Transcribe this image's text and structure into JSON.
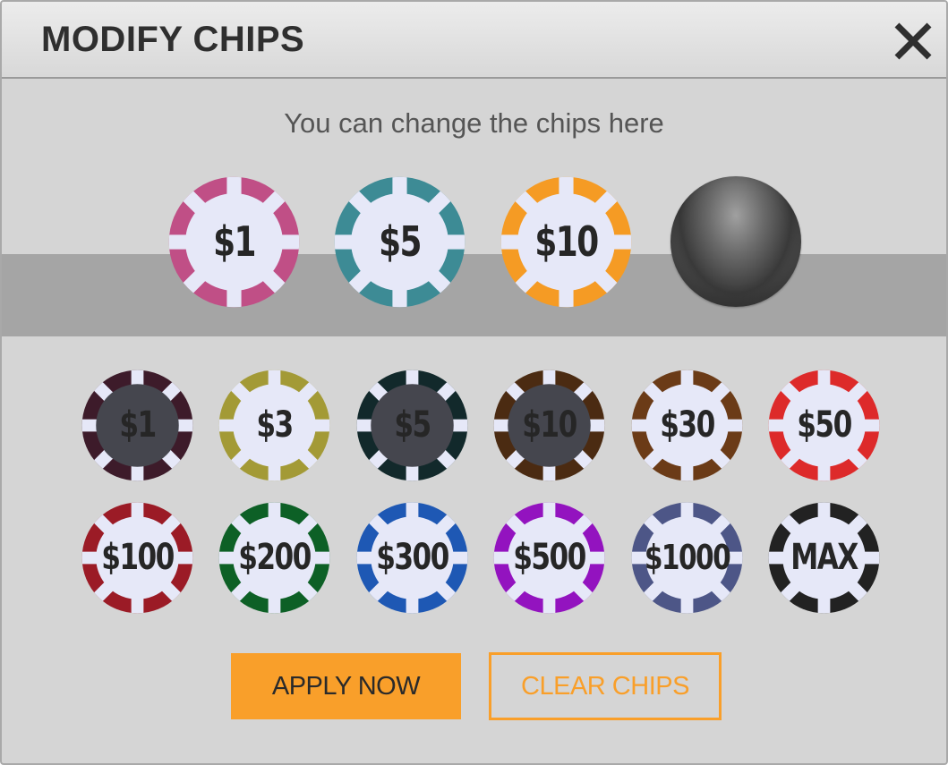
{
  "dialog": {
    "title": "MODIFY CHIPS",
    "subtitle": "You can change the chips here",
    "close_icon": "close-icon"
  },
  "selected_chips": [
    {
      "label": "$1",
      "color": "#c04f86",
      "inner": "#e6e8f8"
    },
    {
      "label": "$5",
      "color": "#3d8b95",
      "inner": "#e6e8f8"
    },
    {
      "label": "$10",
      "color": "#f59b24",
      "inner": "#e6e8f8"
    }
  ],
  "empty_slot": "empty-chip-slot",
  "available_chips": [
    {
      "label": "$1",
      "color": "#3d1b2a",
      "inner": "#45464e"
    },
    {
      "label": "$3",
      "color": "#a39a36",
      "inner": "#e6e8f8"
    },
    {
      "label": "$5",
      "color": "#12292b",
      "inner": "#45464e"
    },
    {
      "label": "$10",
      "color": "#4b2b12",
      "inner": "#45464e"
    },
    {
      "label": "$30",
      "color": "#6b3b17",
      "inner": "#e6e8f8"
    },
    {
      "label": "$50",
      "color": "#dd2a2a",
      "inner": "#e6e8f8"
    },
    {
      "label": "$100",
      "color": "#9b1b26",
      "inner": "#e6e8f8"
    },
    {
      "label": "$200",
      "color": "#0d6026",
      "inner": "#e6e8f8"
    },
    {
      "label": "$300",
      "color": "#1e58b4",
      "inner": "#e6e8f8"
    },
    {
      "label": "$500",
      "color": "#9313bf",
      "inner": "#e6e8f8"
    },
    {
      "label": "$1000",
      "color": "#4d5687",
      "inner": "#e6e8f8"
    },
    {
      "label": "MAX",
      "color": "#222222",
      "inner": "#e6e8f8"
    }
  ],
  "buttons": {
    "apply": "APPLY NOW",
    "clear": "CLEAR CHIPS"
  },
  "colors": {
    "accent": "#f99f2a",
    "tray": "#a5a5a5",
    "background": "#d5d5d5"
  }
}
